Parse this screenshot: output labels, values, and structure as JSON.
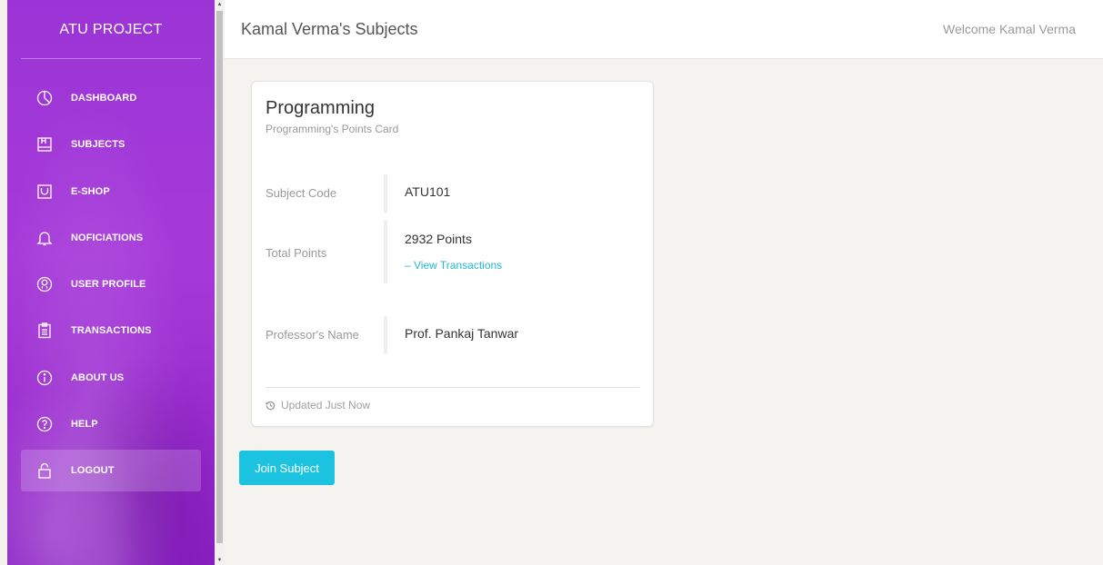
{
  "sidebar": {
    "brand": "ATU PROJECT",
    "items": [
      {
        "label": "DASHBOARD",
        "icon": "pie-chart-icon"
      },
      {
        "label": "SUBJECTS",
        "icon": "book-icon"
      },
      {
        "label": "E-SHOP",
        "icon": "bag-icon"
      },
      {
        "label": "NOFICIATIONS",
        "icon": "bell-icon"
      },
      {
        "label": "USER PROFILE",
        "icon": "user-circle-icon"
      },
      {
        "label": "TRANSACTIONS",
        "icon": "clipboard-icon"
      },
      {
        "label": "ABOUT US",
        "icon": "info-icon"
      },
      {
        "label": "HELP",
        "icon": "help-icon"
      },
      {
        "label": "LOGOUT",
        "icon": "lock-icon",
        "active": true
      }
    ]
  },
  "header": {
    "title": "Kamal Verma's Subjects",
    "welcome": "Welcome Kamal Verma"
  },
  "card": {
    "title": "Programming",
    "subtitle": "Programming's Points Card",
    "subject_code_label": "Subject Code",
    "subject_code": "ATU101",
    "total_points_label": "Total Points",
    "total_points": "2932 Points",
    "view_transactions": "– View Transactions",
    "professor_label": "Professor's Name",
    "professor": "Prof. Pankaj Tanwar",
    "footer": "Updated Just Now"
  },
  "actions": {
    "join_label": "Join Subject"
  },
  "colors": {
    "sidebar_purple": "#9b34d6",
    "accent_cyan": "#1cc3e0",
    "link_cyan": "#23b9d6"
  }
}
